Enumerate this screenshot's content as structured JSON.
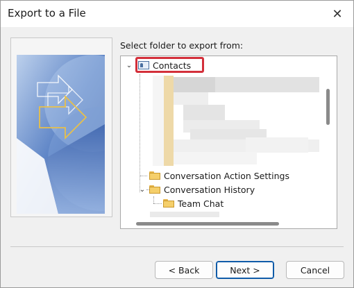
{
  "window": {
    "title": "Export to a File",
    "close_glyph": "✕"
  },
  "prompt": {
    "label": "Select folder to export from:"
  },
  "tree": {
    "root": {
      "label": "Contacts",
      "icon": "contacts-icon",
      "expanded": true,
      "selected": true
    },
    "items": [
      {
        "label": "Conversation Action Settings",
        "icon": "folder-icon"
      },
      {
        "label": "Conversation History",
        "icon": "folder-icon",
        "expanded": true
      },
      {
        "label": "Team Chat",
        "icon": "folder-icon"
      }
    ]
  },
  "buttons": {
    "back": "< Back",
    "next": "Next >",
    "cancel": "Cancel"
  },
  "colors": {
    "highlight": "#d32f3a",
    "accent": "#0f5ba8",
    "folder": "#f5cf6b"
  }
}
